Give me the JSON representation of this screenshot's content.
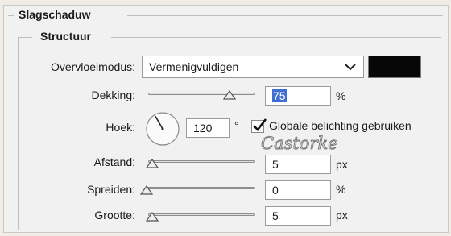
{
  "group_title": "Slagschaduw",
  "section_title": "Structuur",
  "blend": {
    "label": "Overvloeimodus:",
    "value": "Vermenigvuldigen",
    "color": "#070707"
  },
  "opacity": {
    "label": "Dekking:",
    "value": "75",
    "unit": "%",
    "slider_fraction": 0.75
  },
  "angle": {
    "label": "Hoek:",
    "value": "120",
    "unit": "°",
    "degrees": 120
  },
  "global_light": {
    "label": "Globale belichting gebruiken",
    "checked": true
  },
  "distance": {
    "label": "Afstand:",
    "value": "5",
    "unit": "px",
    "slider_fraction": 0.02
  },
  "spread": {
    "label": "Spreiden:",
    "value": "0",
    "unit": "%",
    "slider_fraction": 0.0
  },
  "size": {
    "label": "Grootte:",
    "value": "5",
    "unit": "px",
    "slider_fraction": 0.02
  },
  "watermark": "Castorke",
  "icons": {
    "dropdown": "chevron-down-icon",
    "slider": "triangle-thumb-icon",
    "angle": "angle-dial-icon",
    "check": "checkmark-icon"
  }
}
